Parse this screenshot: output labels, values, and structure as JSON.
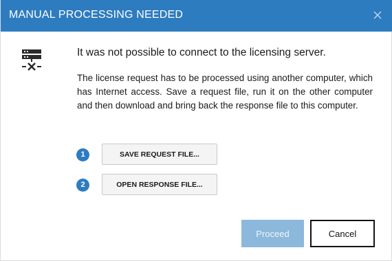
{
  "dialog": {
    "title": "MANUAL PROCESSING NEEDED",
    "heading": "It was not possible to connect to the licensing server.",
    "body": "The license request has to be processed using another computer, which has Internet access. Save a request file, run it on the other computer and then download and bring back the response file to this computer.",
    "steps": [
      {
        "number": "1",
        "button_label": "SAVE REQUEST FILE..."
      },
      {
        "number": "2",
        "button_label": "OPEN RESPONSE FILE..."
      }
    ],
    "proceed_label": "Proceed",
    "cancel_label": "Cancel"
  },
  "icons": {
    "close": "close-icon",
    "server": "server-disconnected-icon"
  },
  "colors": {
    "titlebar": "#2e7cc0",
    "step_badge": "#2e7cc0",
    "proceed_disabled": "#8cb8dc"
  },
  "state": {
    "proceed_enabled": false
  }
}
